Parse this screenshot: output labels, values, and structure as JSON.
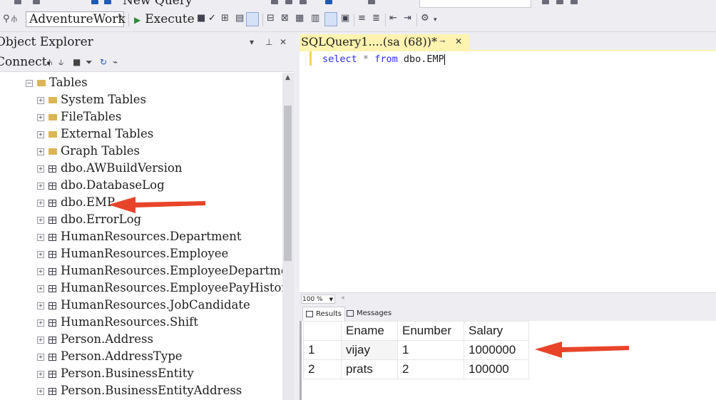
{
  "toolbar": {
    "new_query_label": "New Query",
    "database_selector": "AdventureWork",
    "execute_label": "Execute"
  },
  "object_explorer": {
    "title": "Object Explorer",
    "connect_label": "Connect",
    "tree_items": [
      {
        "label": "Tables",
        "kind": "folder",
        "expanded": true
      },
      {
        "label": "System Tables",
        "kind": "folder"
      },
      {
        "label": "FileTables",
        "kind": "folder"
      },
      {
        "label": "External Tables",
        "kind": "folder"
      },
      {
        "label": "Graph Tables",
        "kind": "folder"
      },
      {
        "label": "dbo.AWBuildVersion",
        "kind": "table"
      },
      {
        "label": "dbo.DatabaseLog",
        "kind": "table"
      },
      {
        "label": "dbo.EMP",
        "kind": "table"
      },
      {
        "label": "dbo.ErrorLog",
        "kind": "table"
      },
      {
        "label": "HumanResources.Department",
        "kind": "table"
      },
      {
        "label": "HumanResources.Employee",
        "kind": "table"
      },
      {
        "label": "HumanResources.EmployeeDepartmentH",
        "kind": "table"
      },
      {
        "label": "HumanResources.EmployeePayHistory",
        "kind": "table"
      },
      {
        "label": "HumanResources.JobCandidate",
        "kind": "table"
      },
      {
        "label": "HumanResources.Shift",
        "kind": "table"
      },
      {
        "label": "Person.Address",
        "kind": "table"
      },
      {
        "label": "Person.AddressType",
        "kind": "table"
      },
      {
        "label": "Person.BusinessEntity",
        "kind": "table"
      },
      {
        "label": "Person.BusinessEntityAddress",
        "kind": "table"
      }
    ]
  },
  "editor": {
    "tab_title": "SQLQuery1....(sa (68))*",
    "query": {
      "kw1": "select",
      "star": "*",
      "kw2": "from",
      "rest": "dbo.EMP"
    },
    "zoom": "100 %"
  },
  "results": {
    "tabs": [
      "Results",
      "Messages"
    ],
    "columns": [
      "Ename",
      "Enumber",
      "Salary"
    ],
    "rows": [
      {
        "num": "1",
        "cells": [
          "vijay",
          "1",
          "1000000"
        ]
      },
      {
        "num": "2",
        "cells": [
          "prats",
          "2",
          "100000"
        ]
      }
    ]
  },
  "colors": {
    "arrow": "#e8442a",
    "tab_active": "#fff3b0"
  }
}
